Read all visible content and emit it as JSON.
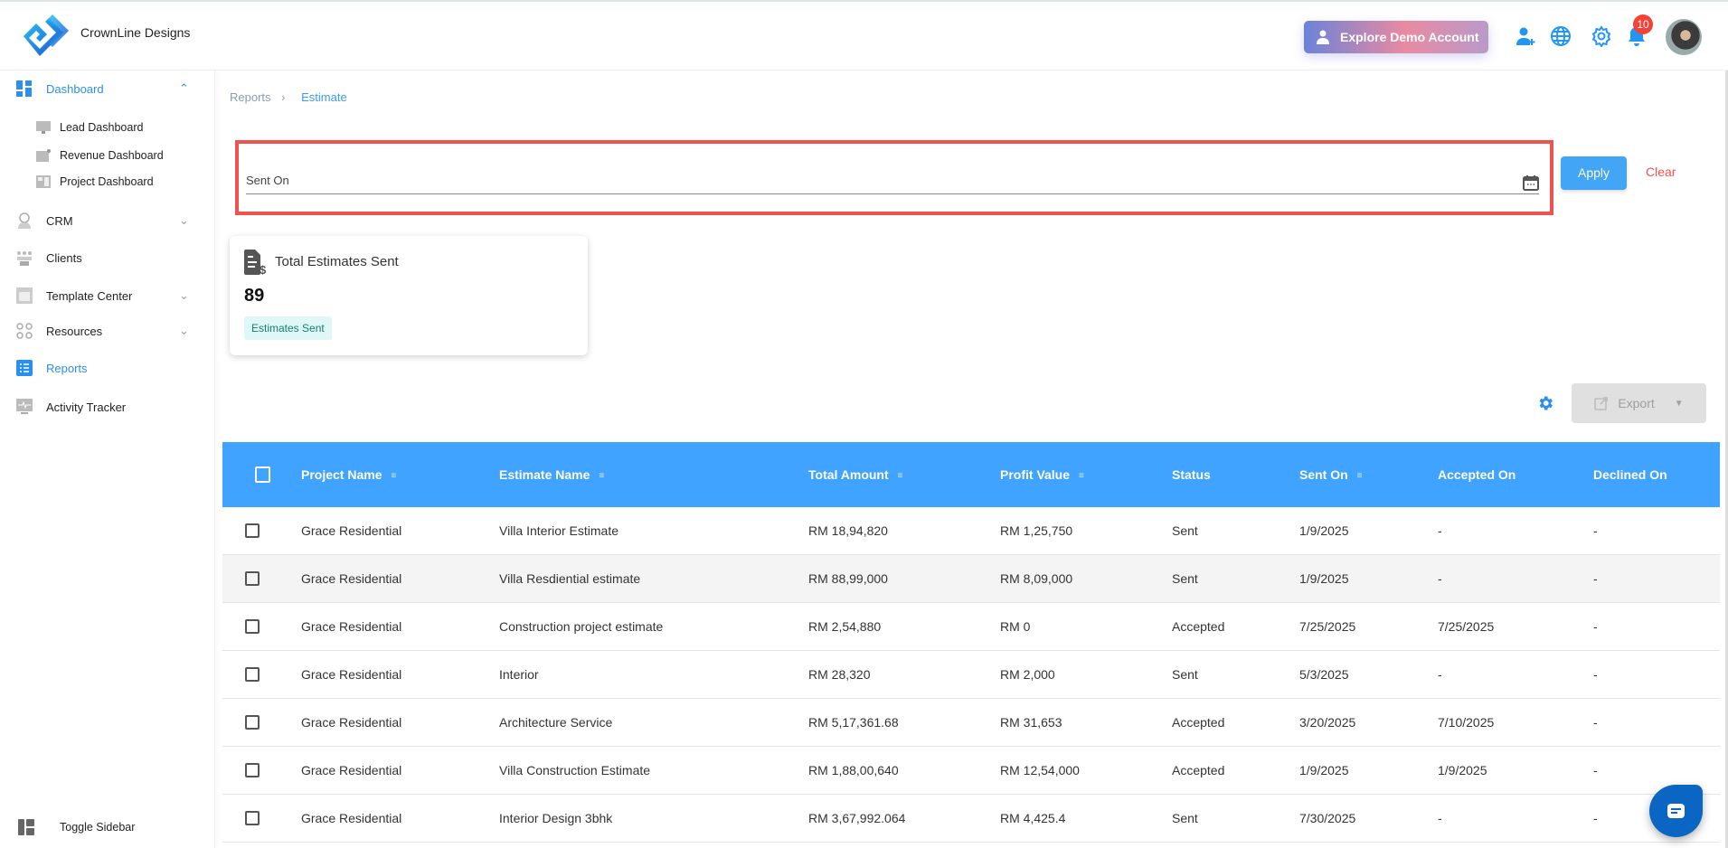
{
  "header": {
    "brand": "CrownLine Designs",
    "demo_button": "Explore Demo Account",
    "notification_count": "10"
  },
  "sidebar": {
    "items": [
      {
        "label": "Dashboard",
        "icon": "dashboard-icon"
      },
      {
        "label": "Lead Dashboard",
        "icon": "lead-dashboard-icon"
      },
      {
        "label": "Revenue Dashboard",
        "icon": "revenue-dashboard-icon"
      },
      {
        "label": "Project Dashboard",
        "icon": "project-dashboard-icon"
      },
      {
        "label": "CRM",
        "icon": "crm-icon"
      },
      {
        "label": "Clients",
        "icon": "clients-icon"
      },
      {
        "label": "Template Center",
        "icon": "template-icon"
      },
      {
        "label": "Resources",
        "icon": "resources-icon"
      },
      {
        "label": "Reports",
        "icon": "reports-icon"
      },
      {
        "label": "Activity Tracker",
        "icon": "activity-icon"
      }
    ],
    "toggle": "Toggle Sidebar"
  },
  "breadcrumb": {
    "parent": "Reports",
    "current": "Estimate"
  },
  "filter": {
    "label": "Sent On",
    "apply": "Apply",
    "clear": "Clear"
  },
  "card": {
    "title": "Total Estimates Sent",
    "value": "89",
    "tag": "Estimates Sent"
  },
  "toolbar": {
    "export": "Export"
  },
  "colors": {
    "accent": "#3fa3ff",
    "danger": "#ef5350"
  },
  "table": {
    "columns": [
      "Project Name",
      "Estimate Name",
      "Total Amount",
      "Profit Value",
      "Status",
      "Sent On",
      "Accepted On",
      "Declined On"
    ],
    "sortable": [
      true,
      true,
      true,
      true,
      false,
      true,
      false,
      false
    ],
    "rows": [
      [
        "Grace Residential",
        "Villa Interior Estimate",
        "RM 18,94,820",
        "RM 1,25,750",
        "Sent",
        "1/9/2025",
        "-",
        "-"
      ],
      [
        "Grace Residential",
        "Villa Resdiential estimate",
        "RM 88,99,000",
        "RM 8,09,000",
        "Sent",
        "1/9/2025",
        "-",
        "-"
      ],
      [
        "Grace Residential",
        "Construction project estimate",
        "RM 2,54,880",
        "RM 0",
        "Accepted",
        "7/25/2025",
        "7/25/2025",
        "-"
      ],
      [
        "Grace Residential",
        "Interior",
        "RM 28,320",
        "RM 2,000",
        "Sent",
        "5/3/2025",
        "-",
        "-"
      ],
      [
        "Grace Residential",
        "Architecture Service",
        "RM 5,17,361.68",
        "RM 31,653",
        "Accepted",
        "3/20/2025",
        "7/10/2025",
        "-"
      ],
      [
        "Grace Residential",
        "Villa Construction Estimate",
        "RM 1,88,00,640",
        "RM 12,54,000",
        "Accepted",
        "1/9/2025",
        "1/9/2025",
        "-"
      ],
      [
        "Grace Residential",
        "Interior Design 3bhk",
        "RM 3,67,992.064",
        "RM 4,425.4",
        "Sent",
        "7/30/2025",
        "-",
        "-"
      ]
    ]
  }
}
